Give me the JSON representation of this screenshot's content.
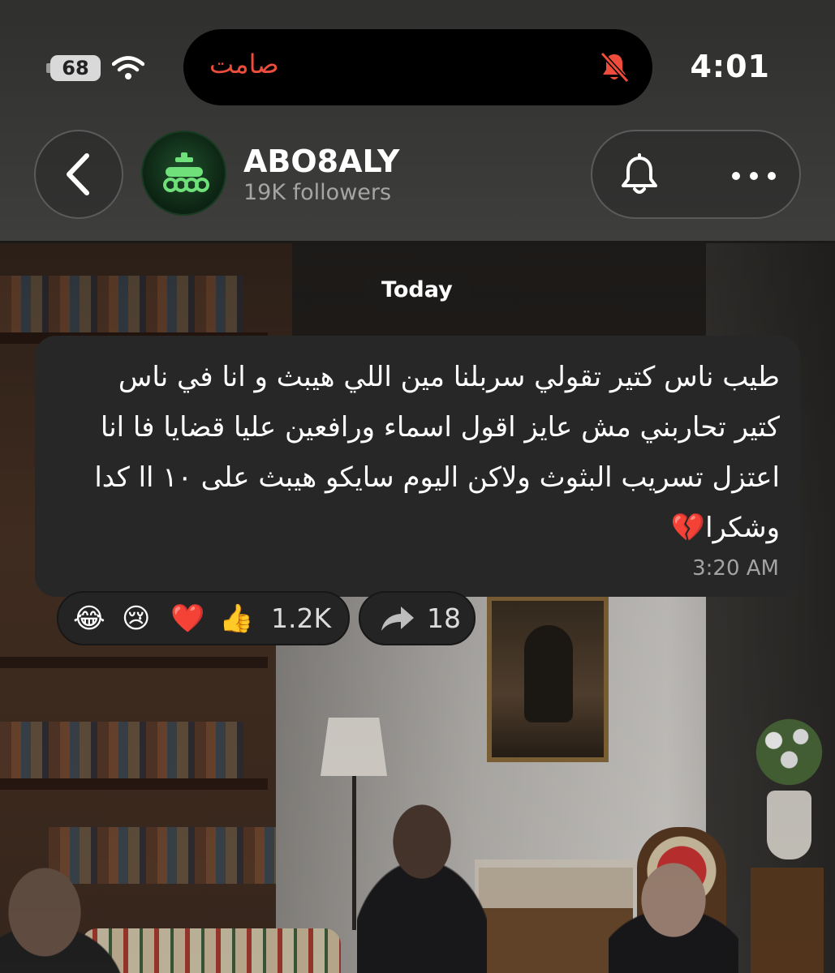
{
  "status_bar": {
    "time": "4:01",
    "battery": "68",
    "island_label": "صامت"
  },
  "header": {
    "channel_name": "ABO8ALY",
    "followers": "19K followers"
  },
  "chat": {
    "date_separator": "Today",
    "message": {
      "text": "طيب ناس كتير تقولي سربلنا مين اللي هيبث و انا في ناس كتير تحاربني مش عايز اقول اسماء ورافعين عليا قضايا فا انا اعتزل تسريب البثوث ولاكن اليوم سايكو هيبث على ١٠ اا كدا وشكرا💔",
      "time": "3:20 AM"
    },
    "reactions": {
      "emojis": [
        "😂",
        "😢",
        "❤️",
        "👍"
      ],
      "count": "1.2K"
    },
    "shares": {
      "count": "18"
    }
  },
  "colors": {
    "silent_red": "#ef4d3b",
    "bubble_bg": "#272727",
    "chrome_bg": "#3e3e3c",
    "avatar_green": "#1f4f2b"
  }
}
